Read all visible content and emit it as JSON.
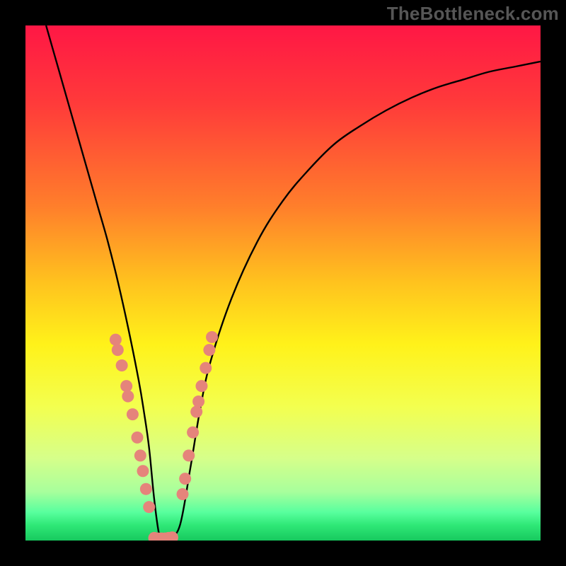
{
  "watermark": "TheBottleneck.com",
  "colors": {
    "frame": "#000000",
    "watermark": "#565656",
    "curve": "#000000",
    "left_dots": "#e5847b",
    "bottom_dots": "#e5847b",
    "right_dots": "#e5847b",
    "gradient_stops": [
      {
        "offset": 0.0,
        "color": "#ff1745"
      },
      {
        "offset": 0.15,
        "color": "#ff3a3a"
      },
      {
        "offset": 0.35,
        "color": "#ff7e2b"
      },
      {
        "offset": 0.5,
        "color": "#ffc31e"
      },
      {
        "offset": 0.62,
        "color": "#fff21a"
      },
      {
        "offset": 0.74,
        "color": "#f3ff4f"
      },
      {
        "offset": 0.84,
        "color": "#d6ff8a"
      },
      {
        "offset": 0.905,
        "color": "#a8ff9c"
      },
      {
        "offset": 0.945,
        "color": "#58ff9e"
      },
      {
        "offset": 0.97,
        "color": "#2fe877"
      },
      {
        "offset": 1.0,
        "color": "#17c95e"
      }
    ]
  },
  "chart_data": {
    "type": "line",
    "title": "",
    "xlabel": "",
    "ylabel": "",
    "xlim": [
      0,
      100
    ],
    "ylim": [
      0,
      100
    ],
    "series": [
      {
        "name": "bottleneck-curve",
        "x": [
          4,
          6,
          8,
          10,
          12,
          14,
          16,
          18,
          20,
          22,
          23,
          24,
          25,
          26,
          27,
          28,
          30,
          32,
          34,
          36,
          40,
          45,
          50,
          55,
          60,
          65,
          70,
          75,
          80,
          85,
          90,
          95,
          100
        ],
        "y": [
          100,
          93,
          86,
          79,
          72,
          65,
          58,
          50,
          41,
          31,
          25,
          18,
          8,
          1,
          0.5,
          0.5,
          3,
          14,
          26,
          35,
          47,
          58,
          66,
          72,
          77,
          80.5,
          83.5,
          86,
          88,
          89.5,
          91,
          92,
          93
        ]
      }
    ],
    "markers": {
      "left": [
        {
          "x": 17.5,
          "y": 39
        },
        {
          "x": 17.9,
          "y": 37
        },
        {
          "x": 18.7,
          "y": 34
        },
        {
          "x": 19.6,
          "y": 30
        },
        {
          "x": 19.9,
          "y": 28
        },
        {
          "x": 20.8,
          "y": 24.5
        },
        {
          "x": 21.7,
          "y": 20
        },
        {
          "x": 22.3,
          "y": 16.5
        },
        {
          "x": 22.8,
          "y": 13.5
        },
        {
          "x": 23.4,
          "y": 10
        },
        {
          "x": 24.0,
          "y": 6.5
        }
      ],
      "bottom": [
        {
          "x": 25.0,
          "y": 0.5
        },
        {
          "x": 25.7,
          "y": 0.4
        },
        {
          "x": 26.4,
          "y": 0.4
        },
        {
          "x": 27.1,
          "y": 0.4
        },
        {
          "x": 27.8,
          "y": 0.5
        },
        {
          "x": 28.5,
          "y": 0.6
        }
      ],
      "right": [
        {
          "x": 30.5,
          "y": 9
        },
        {
          "x": 31.0,
          "y": 12
        },
        {
          "x": 31.7,
          "y": 16.5
        },
        {
          "x": 32.5,
          "y": 21
        },
        {
          "x": 33.2,
          "y": 25
        },
        {
          "x": 33.6,
          "y": 27
        },
        {
          "x": 34.2,
          "y": 30
        },
        {
          "x": 35.0,
          "y": 33.5
        },
        {
          "x": 35.7,
          "y": 37
        },
        {
          "x": 36.2,
          "y": 39.5
        }
      ]
    }
  }
}
